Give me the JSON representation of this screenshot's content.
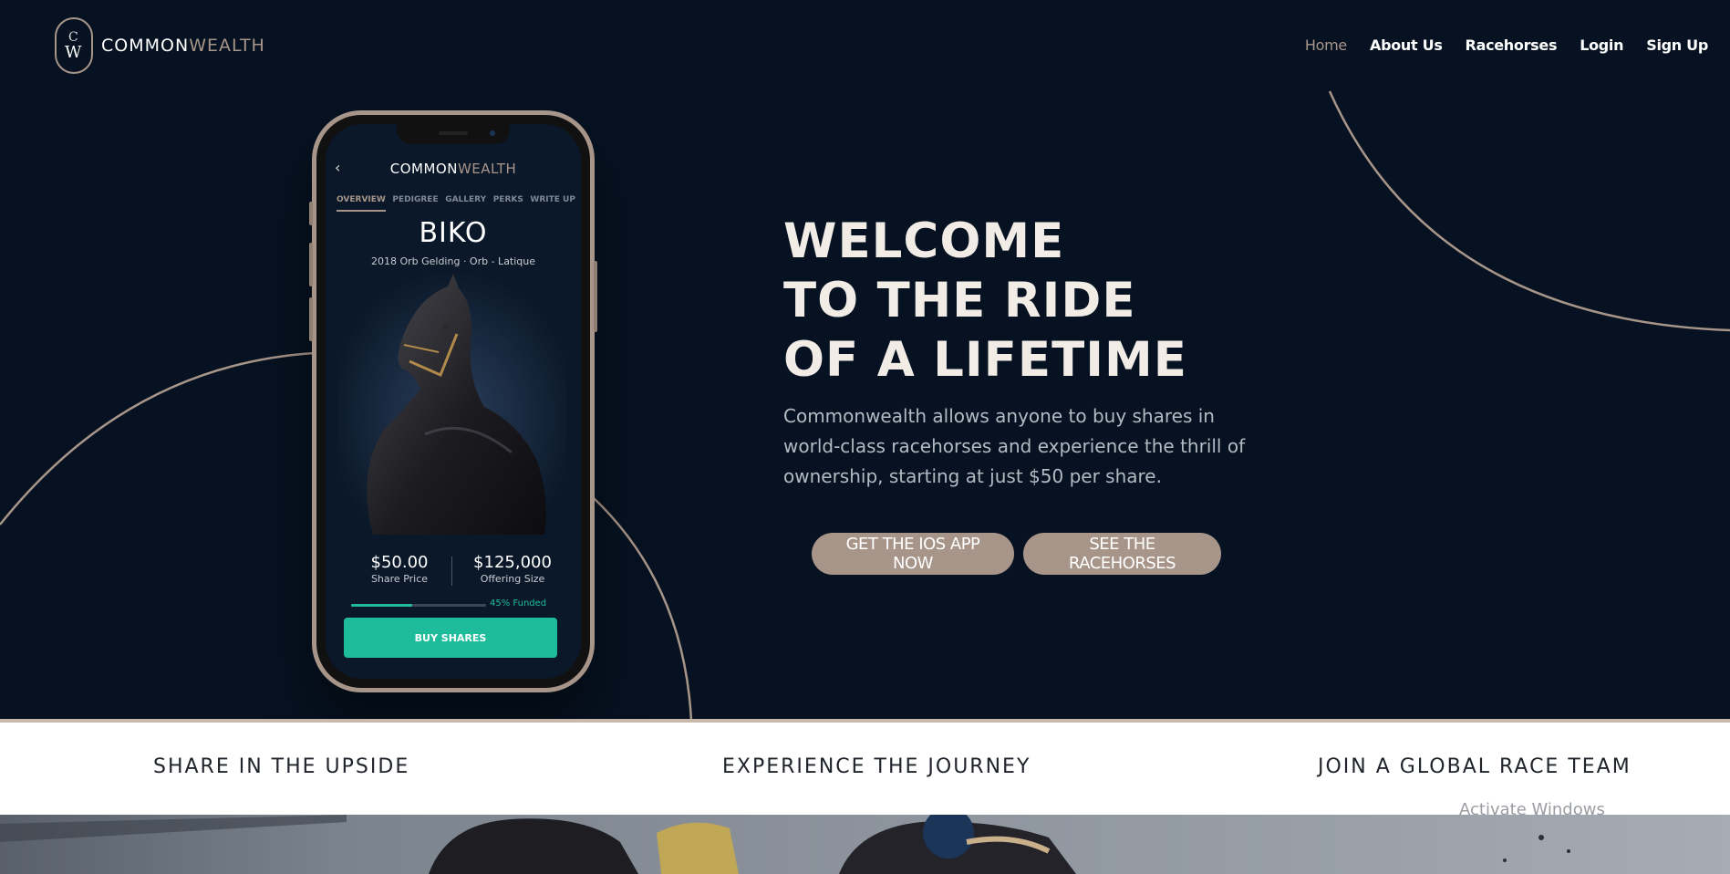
{
  "brand": {
    "name_part1": "COMMON",
    "name_part2": "WEALTH",
    "badge_top": "C",
    "badge_bottom": "W"
  },
  "nav": [
    {
      "label": "Home",
      "active": true
    },
    {
      "label": "About Us"
    },
    {
      "label": "Racehorses"
    },
    {
      "label": "Login"
    },
    {
      "label": "Sign Up"
    }
  ],
  "phone": {
    "back_glyph": "‹",
    "title_part1": "COMMON",
    "title_part2": "WEALTH",
    "tabs": [
      "OVERVIEW",
      "PEDIGREE",
      "GALLERY",
      "PERKS",
      "WRITE UP"
    ],
    "horse_name": "BIKO",
    "horse_sub": "2018 Orb Gelding · Orb - Latique",
    "share_price": "$50.00",
    "share_price_label": "Share Price",
    "offering_size": "$125,000",
    "offering_size_label": "Offering Size",
    "funded_fraction": 0.45,
    "funded_label": "45% Funded",
    "buy_label": "BUY SHARES"
  },
  "hero": {
    "title_lines": [
      "WELCOME",
      "TO THE RIDE",
      "OF A LIFETIME"
    ],
    "description": "Commonwealth allows anyone to buy shares in world-class racehorses and experience the thrill of ownership, starting at just $50 per share.",
    "btn_ios": "GET THE IOS APP NOW",
    "btn_racehorses": "SEE THE RACEHORSES"
  },
  "features": [
    "SHARE IN THE UPSIDE",
    "EXPERIENCE THE JOURNEY",
    "JOIN A GLOBAL RACE TEAM"
  ],
  "watermark": "Activate Windows",
  "colors": {
    "navy": "#061221",
    "tan": "#a8958a",
    "teal": "#1fbc9c",
    "white": "#ffffff"
  }
}
